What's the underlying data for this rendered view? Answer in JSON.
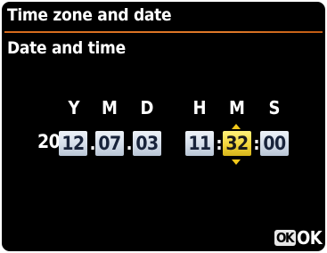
{
  "menu": {
    "title": "Time zone and date",
    "subtitle": "Date and time"
  },
  "columns": {
    "year": "Y",
    "month": "M",
    "day": "D",
    "hour": "H",
    "minute": "M",
    "second": "S"
  },
  "date": {
    "year_prefix": "20",
    "year": "12",
    "month": "07",
    "day": "03"
  },
  "time": {
    "hour": "11",
    "minute": "32",
    "second": "00"
  },
  "separators": {
    "date": ".",
    "time": ":"
  },
  "selected_field": "minute",
  "footer": {
    "button_icon": "OK",
    "button_label": "OK",
    "icon_name": "ok-button-icon"
  },
  "colors": {
    "background": "#000000",
    "title_rule": "#e07a2a",
    "field_normal": "#d4dde9",
    "field_selected": "#f2d53c",
    "arrow": "#f2c81a"
  }
}
